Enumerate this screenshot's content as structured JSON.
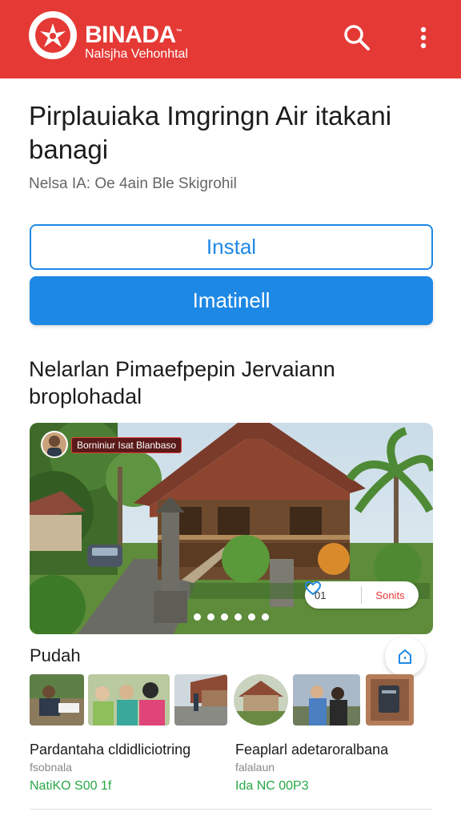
{
  "app": {
    "brand": "BINADA",
    "brand_mark": "™",
    "subtitle": "Nalsjha Vehonhtal"
  },
  "article": {
    "title": "Pirplauiaka Imgringn Air itakani banagi",
    "meta": "Nelsa IA: Oe 4ain Ble Skigrohil"
  },
  "actions": {
    "install_label": "Instal",
    "primary_label": "Imatinell"
  },
  "section": {
    "title": "Nelarlan Pimaefpepin Jervaiann broplohadal"
  },
  "hero": {
    "tag": "Borniniur Isat Blanbaso",
    "likes": "01",
    "details_label": "Sonits",
    "slide_count": 6,
    "active_slide": 1
  },
  "gallery": {
    "title": "Pudah"
  },
  "cards": [
    {
      "title": "Pardantaha cldidliciotring",
      "category": "fsobnala",
      "price": "NatiKO S00 1f"
    },
    {
      "title": "Feaplarl adetaroralbana",
      "category": "falalaun",
      "price": "Ida NC 00P3"
    }
  ],
  "colors": {
    "appbar": "#e53935",
    "accent": "#1e88e5",
    "price": "#27a745"
  },
  "icons": {
    "search": "search-icon",
    "more": "more-vert-icon",
    "like": "heart-icon",
    "fab": "bookmark-icon"
  }
}
